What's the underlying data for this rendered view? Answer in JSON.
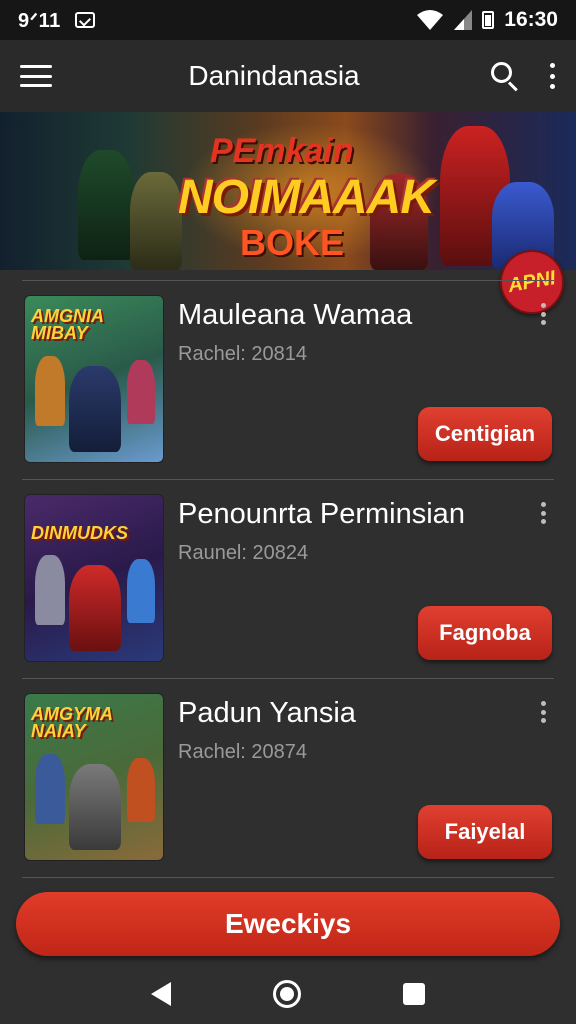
{
  "status_bar": {
    "time_left": "9ᐟ11",
    "time_right": "16:30"
  },
  "app_bar": {
    "title": "Danindanasia",
    "icons": [
      "menu-icon",
      "search-icon",
      "more-vert-icon"
    ]
  },
  "banner": {
    "line1": "PEmkain",
    "line2": "NOIMAAAK",
    "line3": "BOKE",
    "badge": "APNI"
  },
  "items": [
    {
      "name": "Mauleana Wamaa",
      "meta": "Rachel: 20814",
      "action": "Centigian",
      "thumb_title": "AMGNIA MIBAY",
      "thumb_colors": [
        "#3a8a5a",
        "#2a3a6a",
        "#6a9ad0"
      ]
    },
    {
      "name": "Penounrta Perminsian",
      "meta": "Raunel: 20824",
      "action": "Fagnoba",
      "thumb_title": "DINMUDKS",
      "thumb_colors": [
        "#4a2a6a",
        "#b02020",
        "#2a3a7a"
      ]
    },
    {
      "name": "Padun Yansia",
      "meta": "Rachel: 20874",
      "action": "Faiyelal",
      "thumb_title": "AMGYMA NAIAY",
      "thumb_colors": [
        "#3a7a4a",
        "#5a5a5a",
        "#c05020"
      ]
    }
  ],
  "cta": {
    "label": "Eweckiys"
  },
  "colors": {
    "accent": "#d6311f",
    "background": "#2f2f2f",
    "appbar": "#2a2a2a",
    "statusbar": "#161616",
    "meta_text": "#9a9a9a"
  }
}
